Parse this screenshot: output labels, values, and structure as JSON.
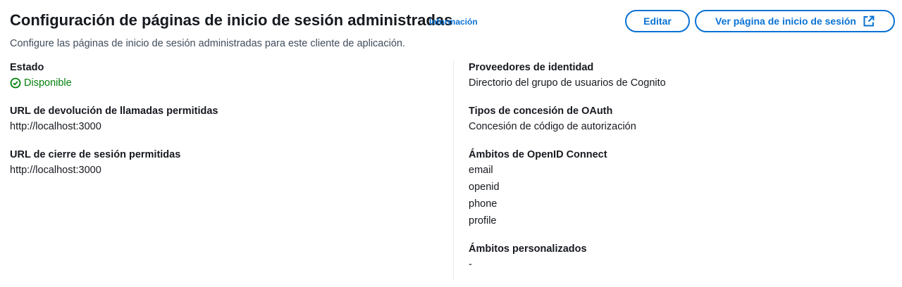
{
  "header": {
    "title": "Configuración de páginas de inicio de sesión administradas",
    "info_link": "Información",
    "description": "Configure las páginas de inicio de sesión administradas para este cliente de aplicación.",
    "edit_button": "Editar",
    "view_button": "Ver página de inicio de sesión"
  },
  "left": {
    "status_label": "Estado",
    "status_value": "Disponible",
    "callback_label": "URL de devolución de llamadas permitidas",
    "callback_value": "http://localhost:3000",
    "signout_label": "URL de cierre de sesión permitidas",
    "signout_value": "http://localhost:3000"
  },
  "right": {
    "idp_label": "Proveedores de identidad",
    "idp_value": "Directorio del grupo de usuarios de Cognito",
    "grant_label": "Tipos de concesión de OAuth",
    "grant_value": "Concesión de código de autorización",
    "oidc_label": "Ámbitos de OpenID Connect",
    "oidc_scopes": [
      "email",
      "openid",
      "phone",
      "profile"
    ],
    "custom_label": "Ámbitos personalizados",
    "custom_value": "-"
  },
  "colors": {
    "accent": "#0972d3",
    "success": "#037f0c",
    "text": "#16191f"
  },
  "icons": {
    "status": "check-circle-icon",
    "external": "external-link-icon"
  }
}
